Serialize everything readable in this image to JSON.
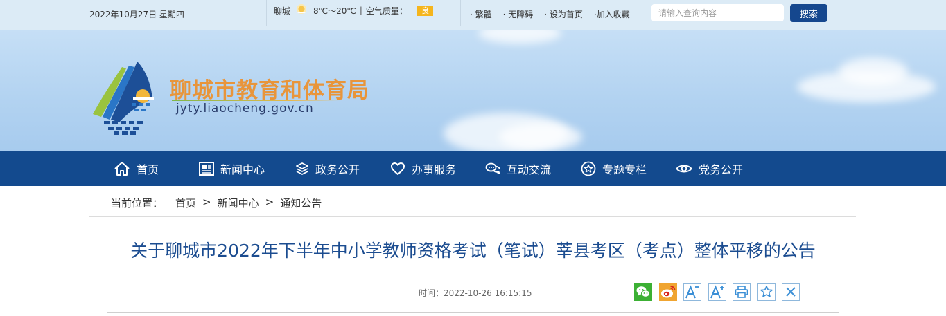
{
  "topbar": {
    "date": "2022年10月27日 星期四",
    "weather": {
      "city": "聊城",
      "temperature": "8℃～20℃",
      "separator": "|",
      "air_quality_label": "空气质量：",
      "air_quality_value": "良",
      "air_quality_color": "#f5b51d",
      "icon": "sun-icon"
    },
    "links": [
      "· 繁體",
      "· 无障碍",
      "· 设为首页",
      "·加入收藏"
    ],
    "search": {
      "placeholder": "请输入查询内容",
      "button_label": "搜索"
    }
  },
  "banner": {
    "site_name": "聊城市教育和体育局",
    "domain": "jyty.liaocheng.gov.cn"
  },
  "nav": {
    "items": [
      {
        "label": "首页",
        "icon": "home-icon"
      },
      {
        "label": "新闻中心",
        "icon": "newspaper-icon"
      },
      {
        "label": "政务公开",
        "icon": "layers-icon"
      },
      {
        "label": "办事服务",
        "icon": "heart-icon"
      },
      {
        "label": "互动交流",
        "icon": "chat-icon"
      },
      {
        "label": "专题专栏",
        "icon": "star-circle-icon"
      },
      {
        "label": "党务公开",
        "icon": "eye-icon"
      }
    ]
  },
  "breadcrumb": {
    "label": "当前位置：",
    "items": [
      "首页",
      "新闻中心",
      "通知公告"
    ],
    "separator": ">"
  },
  "article": {
    "title": "关于聊城市2022年下半年中小学教师资格考试（笔试）莘县考区（考点）整体平移的公告",
    "time_label": "时间：",
    "time_value": "2022-10-26 16:15:15"
  },
  "tools": [
    "wechat-share-icon",
    "weibo-share-icon",
    "font-decrease-icon",
    "font-increase-icon",
    "print-icon",
    "favorite-icon",
    "close-icon"
  ],
  "colors": {
    "topbar_bg": "#dcebf6",
    "nav_bg": "#134a8e",
    "title": "#1b4c90",
    "site_name": "#e8953b",
    "search_button": "#15478e"
  }
}
